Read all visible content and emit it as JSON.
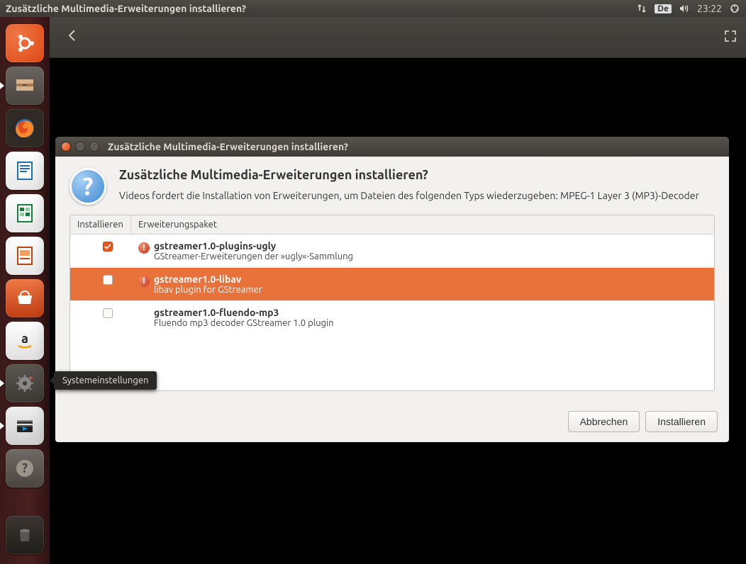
{
  "menubar": {
    "title": "Zusätzliche Multimedia-Erweiterungen installieren?",
    "keyboard": "De",
    "time": "23:22"
  },
  "launcher": {
    "tooltip": "Systemeinstellungen"
  },
  "dialog": {
    "titlebar": "Zusätzliche Multimedia-Erweiterungen installieren?",
    "heading": "Zusätzliche Multimedia-Erweiterungen installieren?",
    "message": "Videos fordert die Installation von Erweiterungen, um Dateien des folgenden Typs wiederzugeben: MPEG-1 Layer 3 (MP3)-Decoder",
    "columns": {
      "install": "Installieren",
      "package": "Erweiterungspaket"
    },
    "packages": [
      {
        "checked": true,
        "warn": true,
        "name": "gstreamer1.0-plugins-ugly",
        "desc": "GStreamer-Erweiterungen der »ugly«-Sammlung",
        "selected": false
      },
      {
        "checked": false,
        "warn": true,
        "name": "gstreamer1.0-libav",
        "desc": "libav plugin for GStreamer",
        "selected": true
      },
      {
        "checked": false,
        "warn": false,
        "name": "gstreamer1.0-fluendo-mp3",
        "desc": "Fluendo mp3 decoder GStreamer 1.0 plugin",
        "selected": false
      }
    ],
    "buttons": {
      "cancel": "Abbrechen",
      "install": "Installieren"
    }
  }
}
